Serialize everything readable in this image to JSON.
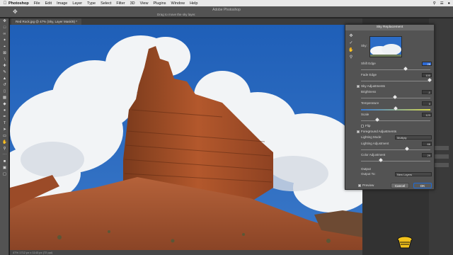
{
  "menubar": {
    "items": [
      "Photoshop",
      "File",
      "Edit",
      "Image",
      "Layer",
      "Type",
      "Select",
      "Filter",
      "3D",
      "View",
      "Plugins",
      "Window",
      "Help"
    ],
    "right_icons": [
      "search-icon",
      "control-center-icon",
      "siri-icon"
    ]
  },
  "window": {
    "title": "Adobe Photoshop"
  },
  "options_bar": {
    "hint": "Drag to move the sky layer."
  },
  "document": {
    "tab": "Red Rock.jpg @ 47% (Sky, Layer Mask/8) *"
  },
  "status": {
    "text": "47%    1712 px x 1143 px (72 ppi)"
  },
  "dialog": {
    "title": "Sky Replacement",
    "sky_label": "Sky:",
    "shift_edge": {
      "label": "Shift Edge",
      "value": "28",
      "level": 0.64
    },
    "fade_edge": {
      "label": "Fade Edge",
      "value": "100",
      "level": 0.99
    },
    "sky_adjustments": {
      "label": "Sky Adjustments",
      "checked": true
    },
    "brightness": {
      "label": "Brightness",
      "value": "-1",
      "level": 0.49
    },
    "temperature": {
      "label": "Temperature",
      "value": "0",
      "level": 0.5
    },
    "scale": {
      "label": "Scale",
      "value": "123",
      "level": 0.23
    },
    "flip": {
      "label": "Flip",
      "checked": false
    },
    "foreground_adjustments": {
      "label": "Foreground Adjustments",
      "checked": true
    },
    "lighting_mode": {
      "label": "Lighting Mode:",
      "value": "Multiply"
    },
    "lighting_adjustment": {
      "label": "Lighting Adjustment",
      "value": "66",
      "level": 0.66
    },
    "color_adjustment": {
      "label": "Color Adjustment",
      "value": "29",
      "level": 0.29
    },
    "output": {
      "section": "Output",
      "label": "Output To:",
      "value": "New Layers"
    },
    "preview": {
      "label": "Preview",
      "checked": true
    },
    "cancel_label": "Cancel",
    "ok_label": "OK"
  },
  "colors": {
    "accent": "#2d6ad6",
    "sky": "#2a63b8",
    "rock": "#a8512a"
  }
}
